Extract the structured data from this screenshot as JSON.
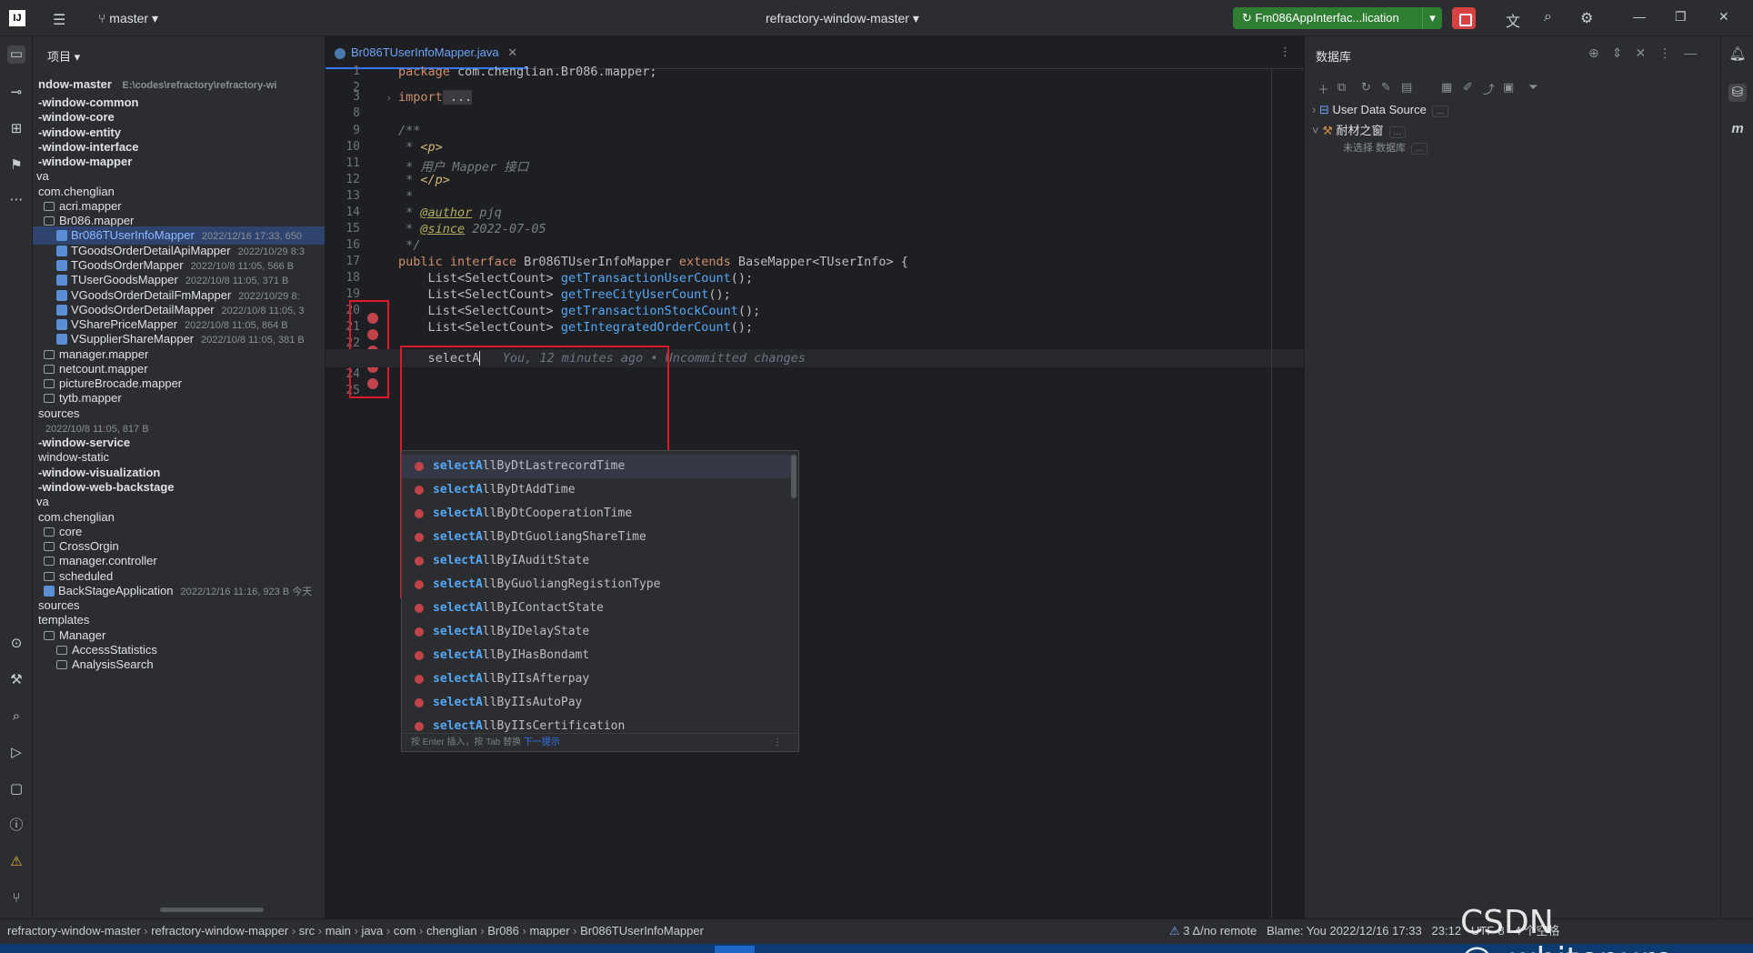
{
  "topbar": {
    "branch": "master",
    "project_title": "refractory-window-master",
    "run_config": "Fm086AppInterfac...lication"
  },
  "project_panel": {
    "header": "项目",
    "root_name": "ndow-master",
    "root_path": "E:\\codes\\refractory\\refractory-wi",
    "rows": [
      {
        "text": "-window-common",
        "meta": "",
        "bold": true
      },
      {
        "text": "-window-core",
        "meta": "",
        "bold": true
      },
      {
        "text": "-window-entity",
        "meta": "",
        "bold": true
      },
      {
        "text": "-window-interface",
        "meta": "",
        "bold": true
      },
      {
        "text": "-window-mapper",
        "meta": "",
        "bold": true
      },
      {
        "text": "va",
        "meta": ""
      },
      {
        "text": "com.chenglian",
        "meta": ""
      },
      {
        "text": "acri.mapper",
        "meta": ""
      },
      {
        "text": "Br086.mapper",
        "meta": ""
      },
      {
        "text": "Br086TUserInfoMapper",
        "meta": "2022/12/16 17:33, 650"
      },
      {
        "text": "TGoodsOrderDetailApiMapper",
        "meta": "2022/10/29 8:3"
      },
      {
        "text": "TGoodsOrderMapper",
        "meta": "2022/10/8 11:05, 566 B"
      },
      {
        "text": "TUserGoodsMapper",
        "meta": "2022/10/8 11:05, 371 B"
      },
      {
        "text": "VGoodsOrderDetailFmMapper",
        "meta": "2022/10/29 8:"
      },
      {
        "text": "VGoodsOrderDetailMapper",
        "meta": "2022/10/8 11:05, 3"
      },
      {
        "text": "VSharePriceMapper",
        "meta": "2022/10/8 11:05, 864 B"
      },
      {
        "text": "VSupplierShareMapper",
        "meta": "2022/10/8 11:05, 381 B"
      },
      {
        "text": "manager.mapper",
        "meta": ""
      },
      {
        "text": "netcount.mapper",
        "meta": ""
      },
      {
        "text": "pictureBrocade.mapper",
        "meta": ""
      },
      {
        "text": "tytb.mapper",
        "meta": ""
      },
      {
        "text": "sources",
        "meta": ""
      },
      {
        "text": "",
        "meta": "2022/10/8 11:05, 817 B"
      },
      {
        "text": "-window-service",
        "meta": "",
        "bold": true
      },
      {
        "text": "window-static",
        "meta": ""
      },
      {
        "text": "-window-visualization",
        "meta": "",
        "bold": true
      },
      {
        "text": "-window-web-backstage",
        "meta": "",
        "bold": true
      },
      {
        "text": "va",
        "meta": ""
      },
      {
        "text": "com.chenglian",
        "meta": ""
      },
      {
        "text": "core",
        "meta": ""
      },
      {
        "text": "CrossOrgin",
        "meta": ""
      },
      {
        "text": "manager.controller",
        "meta": ""
      },
      {
        "text": "scheduled",
        "meta": ""
      },
      {
        "text": "BackStageApplication",
        "meta": "2022/12/16 11:16, 923 B 今天"
      },
      {
        "text": "sources",
        "meta": ""
      },
      {
        "text": "templates",
        "meta": ""
      },
      {
        "text": "Manager",
        "meta": ""
      },
      {
        "text": "AccessStatistics",
        "meta": ""
      },
      {
        "text": "AnalysisSearch",
        "meta": ""
      }
    ]
  },
  "editor": {
    "tab": "Br086TUserInfoMapper.java",
    "problems": "1",
    "gutter": [
      "1",
      "2",
      "3",
      "8",
      "9",
      "10",
      "11",
      "12",
      "13",
      "14",
      "15",
      "16",
      "17",
      "18",
      "19",
      "20",
      "21",
      "22",
      "23",
      "24",
      "25"
    ],
    "lines": {
      "l1_kw": "package",
      "l1_rest": " com.chenglian.Br086.mapper;",
      "l3_kw": "import",
      "l3_rest": " ...",
      "l9": "/**",
      "l10a": " * ",
      "l10b": "<p>",
      "l11": " * 用户 Mapper 接口",
      "l12a": " * ",
      "l12b": "</p>",
      "l13": " *",
      "l14a": " * ",
      "l14b": "@author",
      "l14c": " pjq",
      "l15a": " * ",
      "l15b": "@since",
      "l15c": " 2022-07-05",
      "l16": " */",
      "l17_kw1": "public interface",
      "l17_name": " Br086TUserInfoMapper ",
      "l17_kw2": "extends",
      "l17_rest": " BaseMapper<TUserInfo> {",
      "l18_type": "    List<SelectCount> ",
      "l18_fn": "getTransactionUserCount",
      "l18_end": "();",
      "l19_type": "    List<SelectCount> ",
      "l19_fn": "getTreeCityUserCount",
      "l19_end": "();",
      "l20_type": "    List<SelectCount> ",
      "l20_fn": "getTransactionStockCount",
      "l20_end": "();",
      "l21_type": "    List<SelectCount> ",
      "l21_fn": "getIntegratedOrderCount",
      "l21_end": "();",
      "l23_code": "    selectA",
      "l23_hint": "   You, 12 minutes ago • Uncommitted changes"
    }
  },
  "completion": {
    "prefix": "selectA",
    "items": [
      {
        "hl": "selectA",
        "rest": "llByDtLastrecordTime"
      },
      {
        "hl": "selectA",
        "rest": "llByDtAddTime"
      },
      {
        "hl": "selectA",
        "rest": "llByDtCooperationTime"
      },
      {
        "hl": "selectA",
        "rest": "llByDtGuoliangShareTime"
      },
      {
        "hl": "selectA",
        "rest": "llByIAuditState"
      },
      {
        "hl": "selectA",
        "rest": "llByGuoliangRegistionType"
      },
      {
        "hl": "selectA",
        "rest": "llByIContactState"
      },
      {
        "hl": "selectA",
        "rest": "llByIDelayState"
      },
      {
        "hl": "selectA",
        "rest": "llByIHasBondamt"
      },
      {
        "hl": "selectA",
        "rest": "llByIIsAfterpay"
      },
      {
        "hl": "selectA",
        "rest": "llByIIsAutoPay"
      },
      {
        "hl": "selectA",
        "rest": "llByIIsCertification"
      }
    ],
    "footer_text": "按 Enter 插入，按 Tab 替换",
    "footer_link": "下一提示"
  },
  "database": {
    "header": "数据库",
    "source": "User Data Source",
    "child": "耐材之窗",
    "child_sub": "未选择 数据库"
  },
  "status": {
    "breadcrumb": [
      "refractory-window-master",
      "refractory-window-mapper",
      "src",
      "main",
      "java",
      "com",
      "chenglian",
      "Br086",
      "mapper",
      "Br086TUserInfoMapper"
    ],
    "vcs": "3 Δ/no remote",
    "blame": "Blame: You 2022/12/16 17:33",
    "pos": "23:12",
    "encoding": "UTF-8",
    "indent": "4 个空格"
  },
  "watermark": "CSDN @_whitepure"
}
